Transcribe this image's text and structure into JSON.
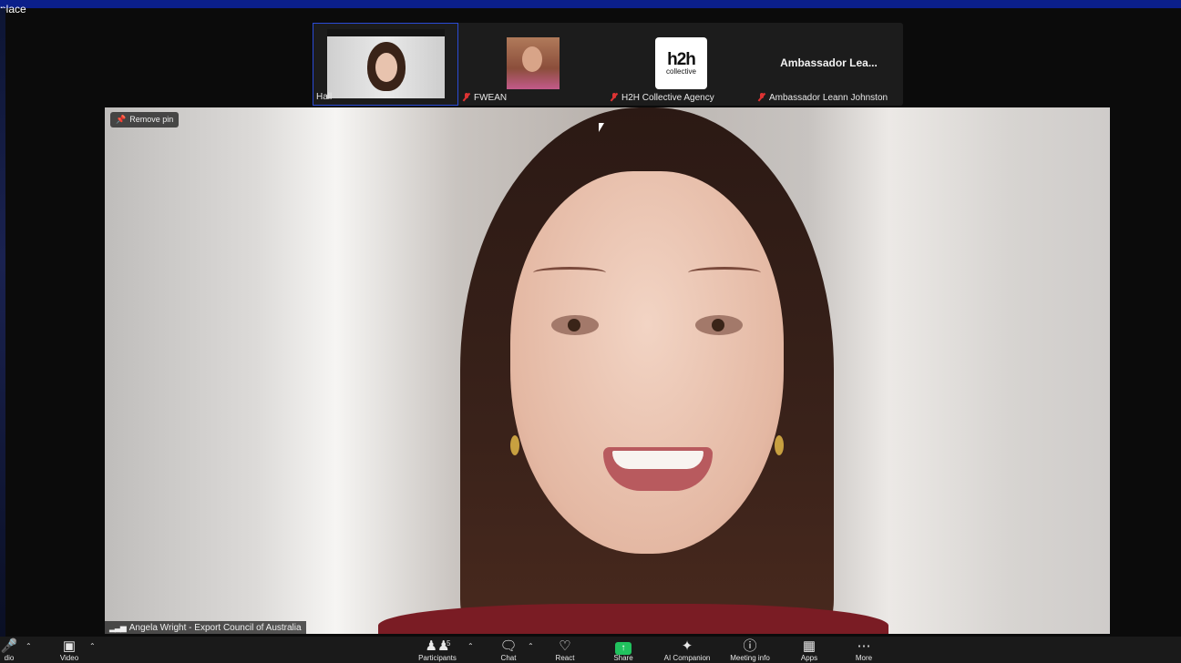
{
  "window": {
    "title_fragment": "place"
  },
  "gallery": {
    "tiles": [
      {
        "name": "Hall",
        "muted": false
      },
      {
        "name": "FWEAN",
        "muted": true
      },
      {
        "name": "H2H Collective Agency",
        "muted": true,
        "logo_line1": "h2h",
        "logo_line2": "collective"
      },
      {
        "name": "Ambassador Leann Johnston",
        "muted": true,
        "display_name": "Ambassador Lea..."
      }
    ]
  },
  "main": {
    "pin_button": "Remove pin",
    "speaker": "Angela Wright - Export Council of Australia"
  },
  "toolbar": {
    "audio": "dio",
    "video": "Video",
    "participants": "Participants",
    "participants_count": "5",
    "chat": "Chat",
    "react": "React",
    "share": "Share",
    "ai": "AI Companion",
    "info": "Meeting info",
    "apps": "Apps",
    "more": "More"
  },
  "colors": {
    "share_accent": "#21c25e",
    "muted_red": "#dd3333",
    "active_border": "#2a4bd6"
  }
}
